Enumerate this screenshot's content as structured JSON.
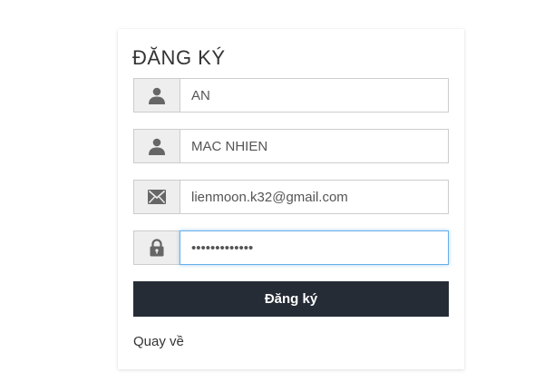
{
  "form": {
    "title": "ĐĂNG KÝ",
    "fields": [
      {
        "icon": "user-icon",
        "value": "AN"
      },
      {
        "icon": "user-icon",
        "value": "MAC NHIEN"
      },
      {
        "icon": "envelope-icon",
        "value": "lienmoon.k32@gmail.com"
      },
      {
        "icon": "lock-icon",
        "value": "•••••••••••••",
        "type": "password"
      }
    ],
    "submit_label": "Đăng ký",
    "back_label": "Quay về"
  },
  "colors": {
    "button_bg": "#262c36",
    "addon_bg": "#eeeeee",
    "icon": "#666666",
    "focus": "#66afe9"
  }
}
